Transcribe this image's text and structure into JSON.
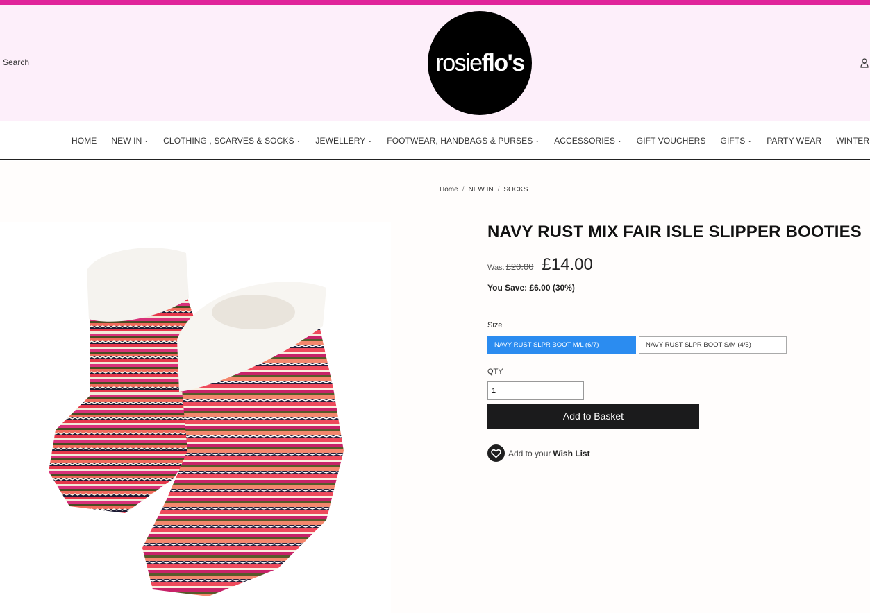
{
  "header": {
    "search_label": "Search",
    "logo": {
      "text_light": "rosie",
      "text_bold": "flo's"
    }
  },
  "nav": {
    "items": [
      {
        "label": "HOME",
        "dropdown": false
      },
      {
        "label": "NEW IN",
        "dropdown": true
      },
      {
        "label": "CLOTHING , SCARVES & SOCKS",
        "dropdown": true
      },
      {
        "label": "JEWELLERY",
        "dropdown": true
      },
      {
        "label": "FOOTWEAR, HANDBAGS & PURSES",
        "dropdown": true
      },
      {
        "label": "ACCESSORIES",
        "dropdown": true
      },
      {
        "label": "GIFT VOUCHERS",
        "dropdown": false
      },
      {
        "label": "GIFTS",
        "dropdown": true
      },
      {
        "label": "PARTY WEAR",
        "dropdown": false
      },
      {
        "label": "WINTER SALE & OFFERS",
        "dropdown": false
      }
    ]
  },
  "breadcrumb": {
    "home": "Home",
    "level1": "NEW IN",
    "current": "SOCKS"
  },
  "product": {
    "title": "NAVY RUST MIX FAIR ISLE SLIPPER BOOTIES",
    "was_label": "Was:",
    "was_price": "£20.00",
    "price": "£14.00",
    "save_text": "You Save: £6.00 (30%)",
    "size_label": "Size",
    "sizes": [
      {
        "label": "NAVY RUST SLPR BOOT M/L (6/7)",
        "selected": true
      },
      {
        "label": "NAVY RUST SLPR BOOT S/M (4/5)",
        "selected": false
      }
    ],
    "qty_label": "QTY",
    "qty_value": "1",
    "add_button": "Add to Basket",
    "wishlist_prefix": "Add to your",
    "wishlist_link": "Wish List"
  },
  "colors": {
    "accent_pink": "#e0249a",
    "header_bg": "#fdeffa",
    "selected_size": "#2b8cf0",
    "button_dark": "#1b1b1c"
  },
  "icons": {
    "account": "user-icon",
    "wishlist": "heart-icon",
    "dropdown": "chevron-down-icon"
  }
}
